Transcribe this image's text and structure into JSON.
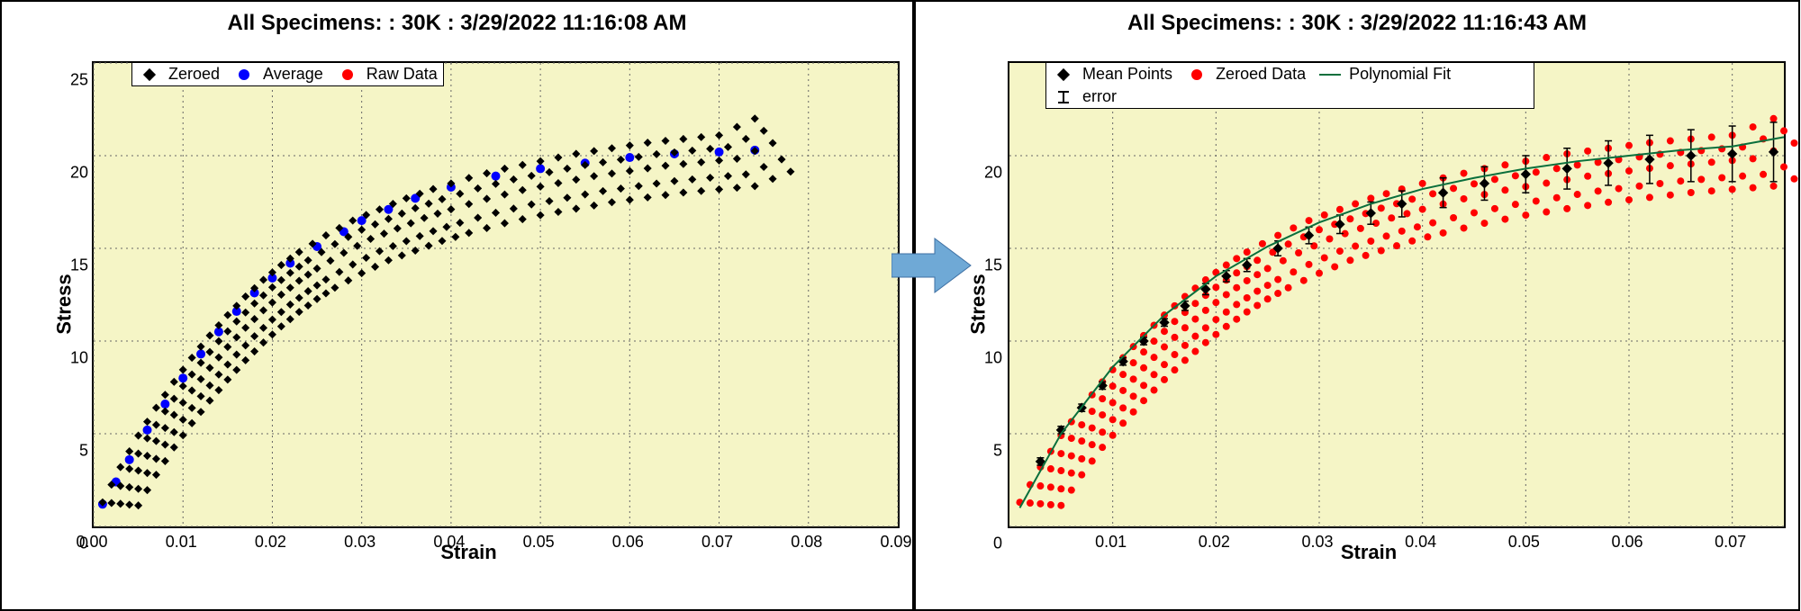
{
  "left": {
    "title": "All Specimens: : 30K  : 3/29/2022 11:16:08 AM",
    "xlabel": "Strain",
    "ylabel": "Stress",
    "legend": {
      "zeroed": "Zeroed",
      "average": "Average",
      "rawdata": "Raw Data"
    },
    "colors": {
      "zeroed": "#000000",
      "average": "#0000ff",
      "rawdata": "#ff0000"
    }
  },
  "right": {
    "title": "All Specimens: : 30K  : 3/29/2022 11:16:43 AM",
    "xlabel": "Strain",
    "ylabel": "Stress",
    "legend": {
      "mean": "Mean Points",
      "zeroed": "Zeroed Data",
      "polyfit": "Polynomial Fit",
      "error": "error"
    },
    "colors": {
      "mean": "#000000",
      "zeroed": "#ff0000",
      "polyfit": "#0a6f3c"
    }
  },
  "chart_data": [
    {
      "type": "scatter",
      "title": "All Specimens: : 30K  : 3/29/2022 11:16:08 AM",
      "xlabel": "Strain",
      "ylabel": "Stress",
      "xlim": [
        0.0,
        0.09
      ],
      "ylim": [
        0,
        25
      ],
      "xticks": [
        0.0,
        0.01,
        0.02,
        0.03,
        0.04,
        0.05,
        0.06,
        0.07,
        0.08,
        0.09
      ],
      "yticks": [
        0,
        5,
        10,
        15,
        20,
        25
      ],
      "series": [
        {
          "name": "Average",
          "marker": "circle",
          "color": "#0000ff",
          "x": [
            0.001,
            0.0025,
            0.004,
            0.006,
            0.008,
            0.01,
            0.012,
            0.014,
            0.016,
            0.018,
            0.02,
            0.022,
            0.025,
            0.028,
            0.03,
            0.033,
            0.036,
            0.04,
            0.045,
            0.05,
            0.055,
            0.06,
            0.065,
            0.07,
            0.074
          ],
          "y": [
            1.2,
            2.4,
            3.6,
            5.2,
            6.6,
            8.0,
            9.3,
            10.5,
            11.6,
            12.6,
            13.4,
            14.2,
            15.1,
            15.9,
            16.5,
            17.1,
            17.7,
            18.3,
            18.9,
            19.3,
            19.6,
            19.9,
            20.1,
            20.2,
            20.3
          ]
        },
        {
          "name": "Zeroed",
          "marker": "diamond",
          "color": "#000000",
          "bands": [
            {
              "offset_x": 0.0,
              "scale_y": 1.0,
              "end": 22.0
            },
            {
              "offset_x": 0.001,
              "scale_y": 0.97,
              "end": 21.0
            },
            {
              "offset_x": 0.002,
              "scale_y": 0.94,
              "end": 20.4
            },
            {
              "offset_x": 0.003,
              "scale_y": 0.9,
              "end": 19.2
            },
            {
              "offset_x": 0.004,
              "scale_y": 0.87,
              "end": 18.2
            }
          ],
          "base_curve_x": [
            0.001,
            0.003,
            0.005,
            0.007,
            0.009,
            0.011,
            0.013,
            0.015,
            0.017,
            0.019,
            0.021,
            0.023,
            0.026,
            0.029,
            0.032,
            0.035,
            0.038,
            0.042,
            0.046,
            0.05,
            0.054,
            0.058,
            0.062,
            0.066,
            0.07,
            0.074
          ],
          "base_curve_y": [
            1.3,
            3.2,
            4.9,
            6.4,
            7.8,
            9.1,
            10.3,
            11.4,
            12.4,
            13.3,
            14.1,
            14.8,
            15.7,
            16.5,
            17.1,
            17.7,
            18.2,
            18.8,
            19.3,
            19.7,
            20.1,
            20.4,
            20.7,
            20.9,
            21.1,
            22.0
          ]
        }
      ]
    },
    {
      "type": "scatter",
      "title": "All Specimens: : 30K  : 3/29/2022 11:16:43 AM",
      "xlabel": "Strain",
      "ylabel": "Stress",
      "xlim": [
        0.0,
        0.075
      ],
      "ylim": [
        0,
        25
      ],
      "xticks": [
        0.01,
        0.02,
        0.03,
        0.04,
        0.05,
        0.06,
        0.07
      ],
      "yticks": [
        0,
        5,
        10,
        15,
        20
      ],
      "series": [
        {
          "name": "Zeroed Data",
          "marker": "circle",
          "color": "#ff0000",
          "bands": [
            {
              "offset_x": 0.0,
              "scale_y": 1.0,
              "end": 22.0
            },
            {
              "offset_x": 0.001,
              "scale_y": 0.97,
              "end": 21.0
            },
            {
              "offset_x": 0.002,
              "scale_y": 0.94,
              "end": 20.4
            },
            {
              "offset_x": 0.003,
              "scale_y": 0.9,
              "end": 19.2
            },
            {
              "offset_x": 0.004,
              "scale_y": 0.87,
              "end": 18.2
            }
          ],
          "base_curve_x": [
            0.001,
            0.003,
            0.005,
            0.007,
            0.009,
            0.011,
            0.013,
            0.015,
            0.017,
            0.019,
            0.021,
            0.023,
            0.026,
            0.029,
            0.032,
            0.035,
            0.038,
            0.042,
            0.046,
            0.05,
            0.054,
            0.058,
            0.062,
            0.066,
            0.07,
            0.074
          ],
          "base_curve_y": [
            1.3,
            3.2,
            4.9,
            6.4,
            7.8,
            9.1,
            10.3,
            11.4,
            12.4,
            13.3,
            14.1,
            14.8,
            15.7,
            16.5,
            17.1,
            17.7,
            18.2,
            18.8,
            19.3,
            19.7,
            20.1,
            20.4,
            20.7,
            20.9,
            21.1,
            22.0
          ]
        },
        {
          "name": "Mean Points",
          "marker": "diamond",
          "color": "#000000",
          "x": [
            0.003,
            0.005,
            0.007,
            0.009,
            0.011,
            0.013,
            0.015,
            0.017,
            0.019,
            0.021,
            0.023,
            0.026,
            0.029,
            0.032,
            0.035,
            0.038,
            0.042,
            0.046,
            0.05,
            0.054,
            0.058,
            0.062,
            0.066,
            0.07,
            0.074
          ],
          "y": [
            3.5,
            5.2,
            6.4,
            7.6,
            8.9,
            10.0,
            11.0,
            11.9,
            12.8,
            13.5,
            14.1,
            15.0,
            15.7,
            16.3,
            16.9,
            17.4,
            18.0,
            18.5,
            19.0,
            19.3,
            19.6,
            19.8,
            20.0,
            20.1,
            20.2
          ],
          "yerr": [
            0.2,
            0.2,
            0.2,
            0.2,
            0.2,
            0.2,
            0.2,
            0.25,
            0.3,
            0.3,
            0.35,
            0.4,
            0.45,
            0.5,
            0.6,
            0.7,
            0.8,
            0.9,
            1.0,
            1.1,
            1.2,
            1.3,
            1.4,
            1.5,
            1.6
          ]
        },
        {
          "name": "Polynomial Fit",
          "marker": "line",
          "color": "#0a6f3c",
          "x": [
            0.001,
            0.005,
            0.01,
            0.015,
            0.02,
            0.025,
            0.03,
            0.035,
            0.04,
            0.045,
            0.05,
            0.055,
            0.06,
            0.065,
            0.07,
            0.075
          ],
          "y": [
            1.0,
            5.0,
            8.6,
            11.4,
            13.5,
            15.1,
            16.4,
            17.4,
            18.2,
            18.8,
            19.3,
            19.7,
            20.0,
            20.3,
            20.5,
            21.0
          ]
        }
      ]
    }
  ]
}
